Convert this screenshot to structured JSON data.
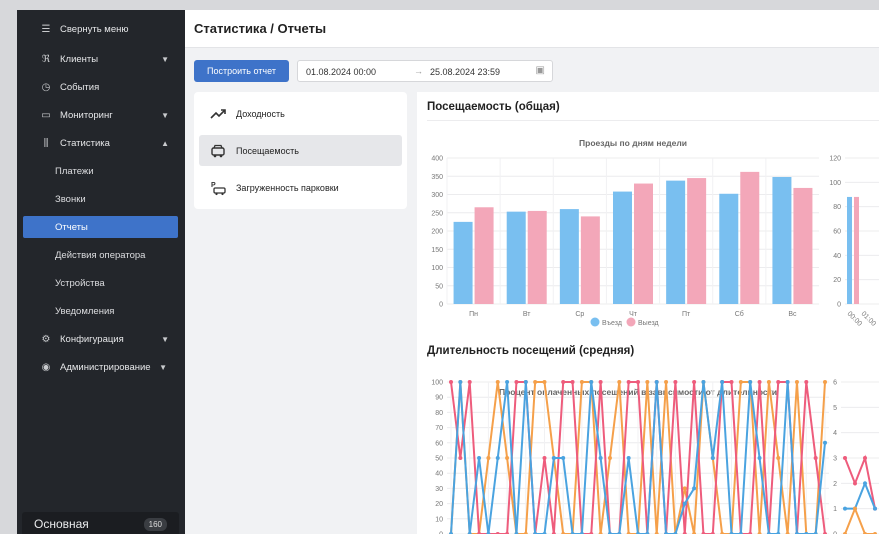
{
  "sidebar": {
    "collapse": {
      "label": "Свернуть меню",
      "icon": "hamburger-icon"
    },
    "items": [
      {
        "label": "Клиенты",
        "icon": "users-icon"
      },
      {
        "label": "События",
        "icon": "clock-icon"
      },
      {
        "label": "Мониторинг",
        "icon": "monitor-icon"
      },
      {
        "label": "Статистика",
        "icon": "bar-chart-icon"
      }
    ],
    "statistics_sub": [
      {
        "label": "Платежи"
      },
      {
        "label": "Звонки"
      },
      {
        "label": "Отчеты"
      },
      {
        "label": "Действия оператора"
      },
      {
        "label": "Устройства"
      },
      {
        "label": "Уведомления"
      }
    ],
    "items2": [
      {
        "label": "Конфигурация",
        "icon": "gear-icon"
      },
      {
        "label": "Администрирование",
        "icon": "eye-icon"
      }
    ],
    "bottom": {
      "label": "Основная",
      "badge": "160"
    }
  },
  "header": {
    "title": "Статистика / Отчеты"
  },
  "toolbar": {
    "build_label": "Построить отчет",
    "date_from": "01.08.2024 00:00",
    "date_sep": "→",
    "date_to": "25.08.2024 23:59"
  },
  "report_menu": [
    {
      "label": "Доходность",
      "icon": "trend-icon"
    },
    {
      "label": "Посещаемость",
      "icon": "car-icon"
    },
    {
      "label": "Загруженность парковки",
      "icon": "parking-icon"
    }
  ],
  "colors": {
    "accent": "#3e73c9",
    "entry": "#79bff0",
    "exit": "#f3a7b9",
    "line_orange": "#f5a04a",
    "line_red": "#ee5c7c",
    "line_blue": "#4aa3e0"
  },
  "chart_data": [
    {
      "type": "bar",
      "section_title": "Посещаемость (общая)",
      "title": "Проезды по дням недели",
      "categories": [
        "Пн",
        "Вт",
        "Ср",
        "Чт",
        "Пт",
        "Сб",
        "Вс"
      ],
      "series": [
        {
          "name": "Въезд",
          "values": [
            225,
            253,
            260,
            308,
            338,
            302,
            348
          ]
        },
        {
          "name": "Выезд",
          "values": [
            265,
            255,
            240,
            330,
            345,
            362,
            318
          ]
        }
      ],
      "ylim": [
        0,
        400
      ],
      "yticks": [
        0,
        50,
        100,
        150,
        200,
        250,
        300,
        350,
        400
      ],
      "legend": "bottom",
      "grid": true
    },
    {
      "type": "bar",
      "partial": true,
      "ylim": [
        0,
        120
      ],
      "yticks": [
        0,
        20,
        40,
        60,
        80,
        100,
        120
      ],
      "series": [
        {
          "name": "Въезд",
          "values": [
            88
          ]
        },
        {
          "name": "Выезд",
          "values": [
            88
          ]
        }
      ],
      "x_tick_labels": [
        "00:00",
        "01:00"
      ]
    },
    {
      "type": "line",
      "section_title": "Длительность посещений (средняя)",
      "title": "Процент оплаченных посещений в зависимости от длительности",
      "ylim": [
        0,
        100
      ],
      "yticks": [
        0,
        10,
        20,
        30,
        40,
        50,
        60,
        70,
        80,
        90,
        100
      ],
      "series": [
        {
          "color": "line_orange",
          "values": [
            0,
            100,
            0,
            0,
            50,
            100,
            50,
            0,
            0,
            100,
            100,
            50,
            0,
            0,
            100,
            100,
            0,
            50,
            100,
            0,
            0,
            100,
            0,
            100,
            0,
            30,
            0,
            100,
            50,
            0,
            0,
            100,
            100,
            0,
            100,
            50,
            0,
            100,
            0,
            0,
            100
          ]
        },
        {
          "color": "line_red",
          "values": [
            100,
            50,
            100,
            0,
            0,
            0,
            0,
            100,
            100,
            0,
            50,
            0,
            100,
            100,
            0,
            0,
            100,
            0,
            0,
            100,
            100,
            0,
            100,
            0,
            100,
            0,
            100,
            0,
            0,
            100,
            100,
            0,
            0,
            100,
            0,
            100,
            100,
            0,
            100,
            50,
            0
          ]
        },
        {
          "color": "line_blue",
          "values": [
            0,
            100,
            0,
            50,
            0,
            50,
            100,
            0,
            100,
            0,
            0,
            50,
            50,
            0,
            0,
            100,
            50,
            0,
            0,
            50,
            0,
            0,
            100,
            0,
            0,
            20,
            30,
            100,
            50,
            100,
            0,
            0,
            100,
            50,
            0,
            0,
            100,
            0,
            0,
            0,
            60
          ]
        }
      ],
      "grid": true
    },
    {
      "type": "line",
      "partial": true,
      "ylim": [
        0,
        6
      ],
      "yticks": [
        0,
        1,
        2,
        3,
        4,
        5,
        6
      ],
      "series": [
        {
          "color": "line_red",
          "values": [
            3,
            2,
            3,
            1
          ]
        },
        {
          "color": "line_blue",
          "values": [
            1,
            1,
            2,
            1
          ]
        },
        {
          "color": "line_orange",
          "values": [
            0,
            1,
            0,
            0
          ]
        }
      ]
    }
  ]
}
